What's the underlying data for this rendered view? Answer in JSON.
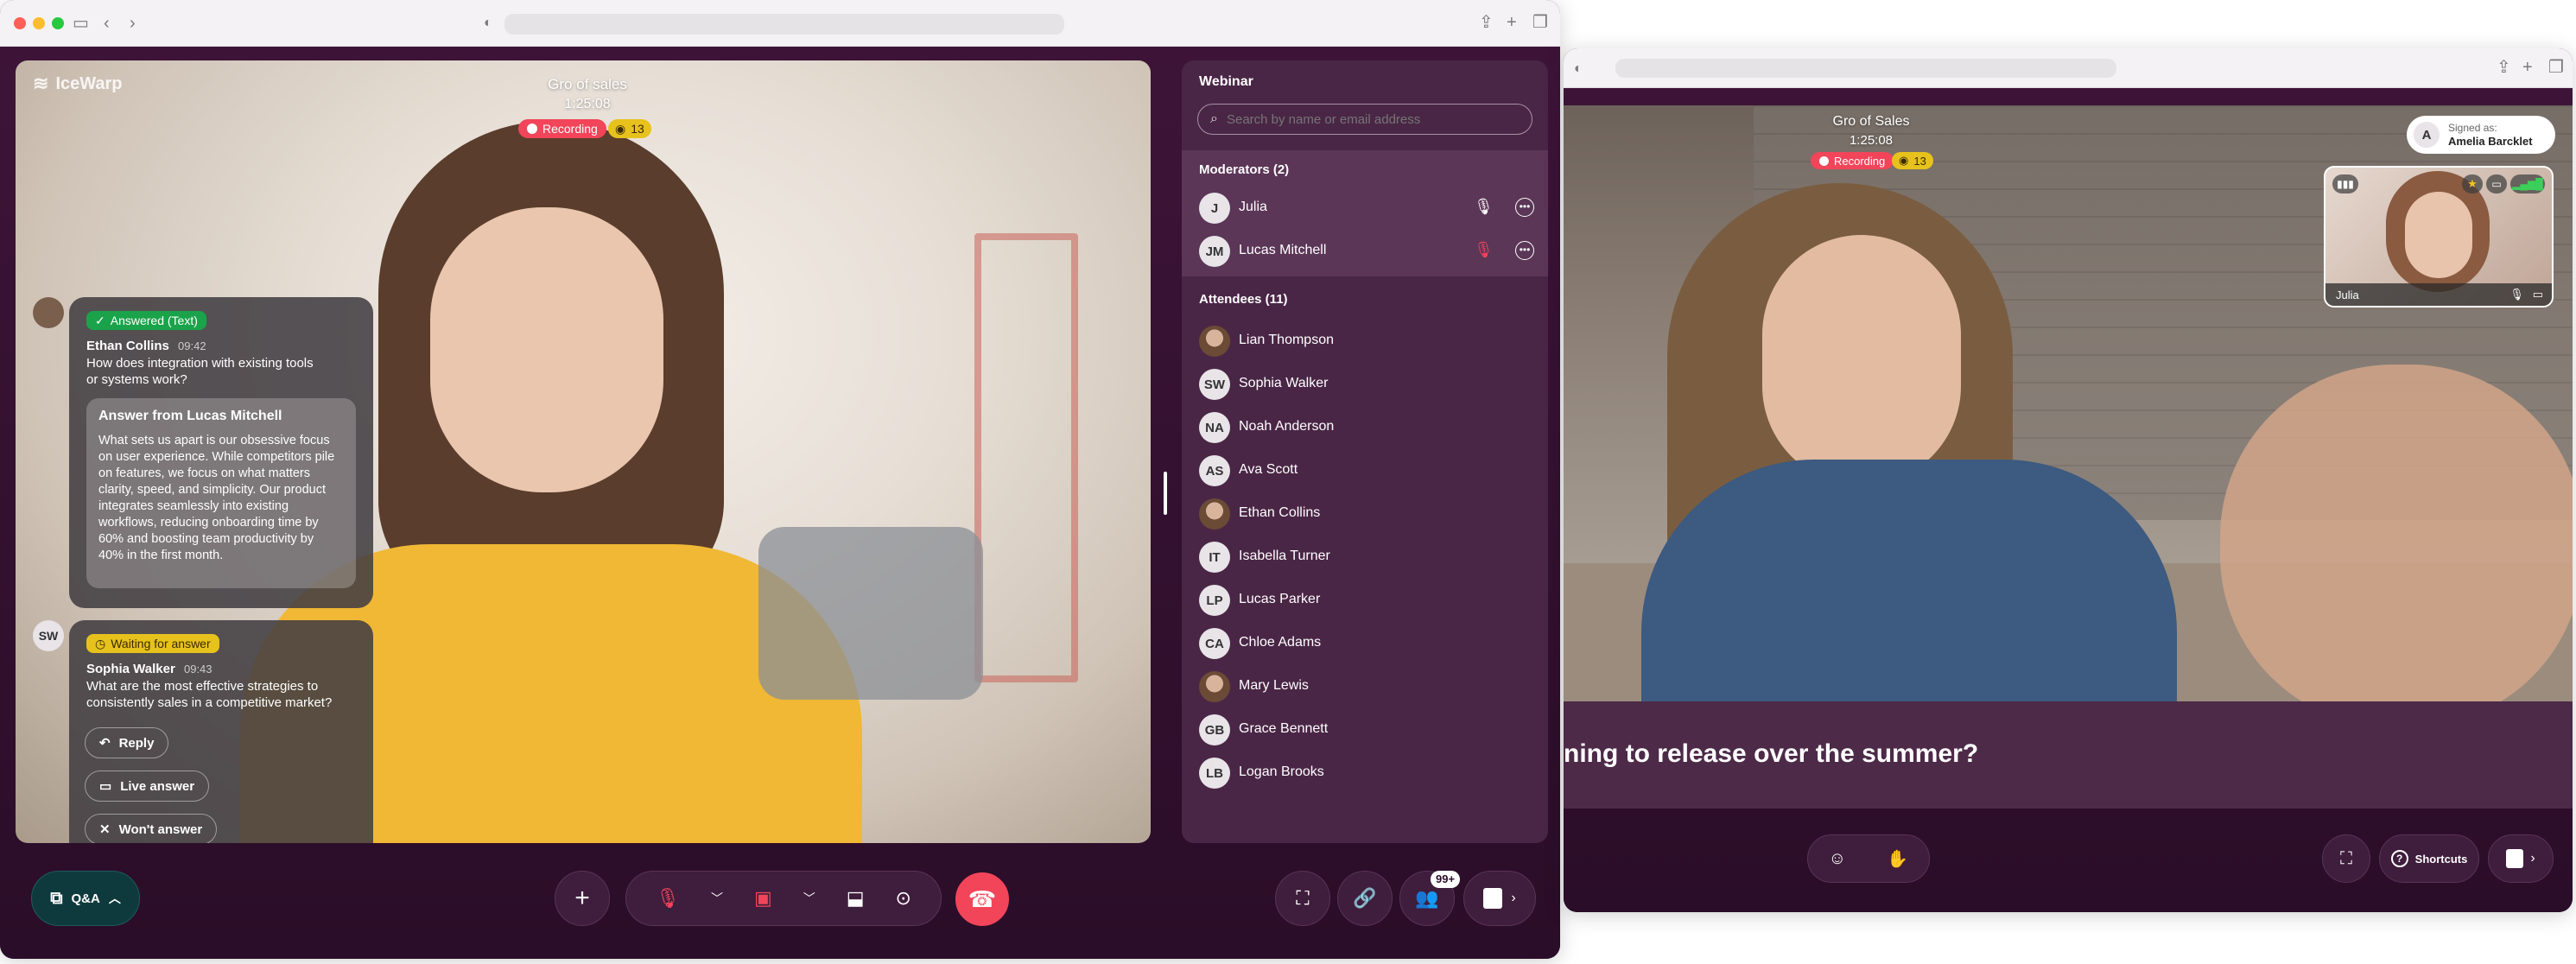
{
  "left": {
    "logo": "IceWarp",
    "meeting": {
      "title": "Gro of sales",
      "timer": "1:25:08",
      "recording": "Recording",
      "viewers": "13"
    },
    "qa": {
      "answered_tag": "Answered (Text)",
      "q1_name": "Ethan Collins",
      "q1_time": "09:42",
      "q1_text": "How does integration with existing tools or systems work?",
      "answer_title": "Answer from Lucas Mitchell",
      "answer_text": "What sets us apart is our obsessive focus on user experience. While competitors pile on features, we focus on what matters clarity, speed, and simplicity. Our product integrates seamlessly into existing workflows, reducing onboarding time by 60% and boosting team productivity by 40% in the first month.",
      "waiting_tag": "Waiting for answer",
      "q2_initials": "SW",
      "q2_name": "Sophia Walker",
      "q2_time": "09:43",
      "q2_text": "What are the most effective strategies to consistently sales in a competitive market?",
      "reply": "Reply",
      "live_answer": "Live answer",
      "wont_answer": "Won't answer"
    },
    "qa_button": "Q&A",
    "badge": "99+",
    "panel": {
      "title": "Webinar",
      "search_placeholder": "Search by name or email address",
      "moderators_header": "Moderators (2)",
      "moderators": [
        {
          "initials": "J",
          "name": "Julia"
        },
        {
          "initials": "JM",
          "name": "Lucas Mitchell"
        }
      ],
      "attendees_header": "Attendees (11)",
      "attendees": [
        {
          "initials": "",
          "name": "Lian Thompson",
          "photo": true
        },
        {
          "initials": "SW",
          "name": "Sophia Walker"
        },
        {
          "initials": "NA",
          "name": "Noah Anderson"
        },
        {
          "initials": "AS",
          "name": "Ava Scott"
        },
        {
          "initials": "",
          "name": "Ethan Collins",
          "photo": true
        },
        {
          "initials": "IT",
          "name": "Isabella Turner"
        },
        {
          "initials": "LP",
          "name": "Lucas Parker"
        },
        {
          "initials": "CA",
          "name": "Chloe Adams"
        },
        {
          "initials": "",
          "name": "Mary Lewis",
          "photo": true
        },
        {
          "initials": "GB",
          "name": "Grace Bennett"
        },
        {
          "initials": "LB",
          "name": "Logan Brooks"
        }
      ]
    }
  },
  "right": {
    "meeting": {
      "title": "Gro of Sales",
      "timer": "1:25:08",
      "recording": "Recording",
      "viewers": "13"
    },
    "signed_as_label": "Signed as:",
    "signed_as_name": "Amelia Barcklet",
    "signed_initial": "A",
    "pip_name": "Julia",
    "caption": "ning to release over the summer?",
    "shortcuts": "Shortcuts"
  },
  "colors": {
    "accent_red": "#f2455a",
    "bg_purple": "#2b0f2a",
    "tag_green": "#1aa34a",
    "tag_yellow": "#e7c21d"
  }
}
